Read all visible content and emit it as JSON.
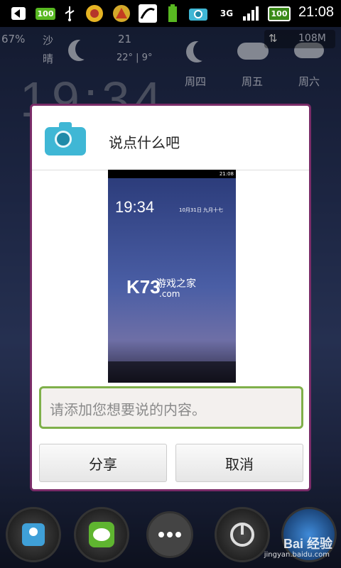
{
  "status_bar": {
    "battery_badge": "100",
    "network": "3G",
    "battery_pct": "100",
    "time": "21:08"
  },
  "widgets": {
    "battery_pct": "67%",
    "weather_text": "沙",
    "condition": "晴",
    "temp_day": "21",
    "temp_range": "22° | 9°",
    "memory": "108M",
    "forecast_days": [
      "周四",
      "周五",
      "周六"
    ]
  },
  "dialog": {
    "title": "说点什么吧",
    "input_placeholder": "请添加您想要说的内容。",
    "share_label": "分享",
    "cancel_label": "取消"
  },
  "thumbnail": {
    "time": "19:34",
    "status_time": "21:08",
    "date_text": "10月31日 九月十七",
    "watermark_big": "K73",
    "watermark_cn": "游戏之家",
    "watermark_com": ".com"
  },
  "watermark": {
    "brand": "Bai 经验",
    "url": "jingyan.baidu.com"
  },
  "colors": {
    "dialog_border": "#7a2c68",
    "input_border": "#7fb04a",
    "camera_icon": "#3fb7d5"
  }
}
